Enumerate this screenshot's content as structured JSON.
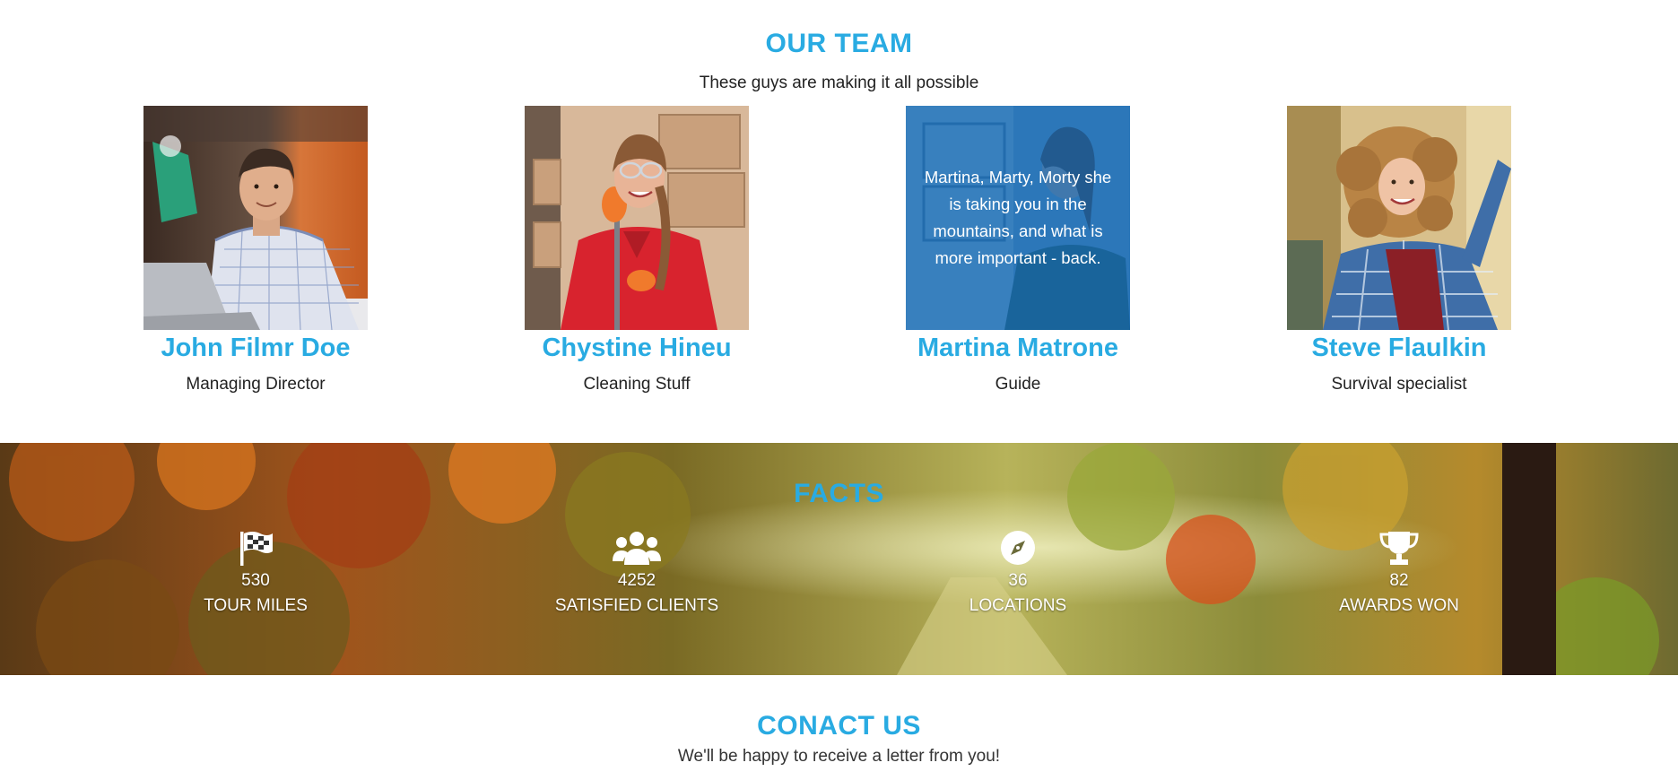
{
  "theme": {
    "accent": "#29abe2",
    "text": "#222222",
    "overlay": "#0060b4"
  },
  "team": {
    "title": "OUR TEAM",
    "subtitle": "These guys are making it all possible",
    "members": [
      {
        "name": "John Filmr Doe",
        "role": "Managing Director",
        "photo": "man-at-laptop-photo"
      },
      {
        "name": "Chystine Hineu",
        "role": "Cleaning Stuff",
        "photo": "woman-with-broom-photo"
      },
      {
        "name": "Martina Matrone",
        "role": "Guide",
        "photo": "woman-in-shop-photo",
        "overlay_text": "Martina, Marty, Morty she is taking you in the mountains, and what is more important - back."
      },
      {
        "name": "Steve Flaulkin",
        "role": "Survival specialist",
        "photo": "curly-hair-woman-photo"
      }
    ]
  },
  "facts": {
    "title": "FACTS",
    "background": "autumn-forest-photo",
    "items": [
      {
        "icon": "checkered-flag-icon",
        "value": "530",
        "label": "TOUR MILES"
      },
      {
        "icon": "users-group-icon",
        "value": "4252",
        "label": "SATISFIED CLIENTS"
      },
      {
        "icon": "compass-icon",
        "value": "36",
        "label": "LOCATIONS"
      },
      {
        "icon": "trophy-icon",
        "value": "82",
        "label": "AWARDS WON"
      }
    ]
  },
  "contact": {
    "title": "CONACT US",
    "subtitle": "We'll be happy to receive a letter from you!"
  }
}
